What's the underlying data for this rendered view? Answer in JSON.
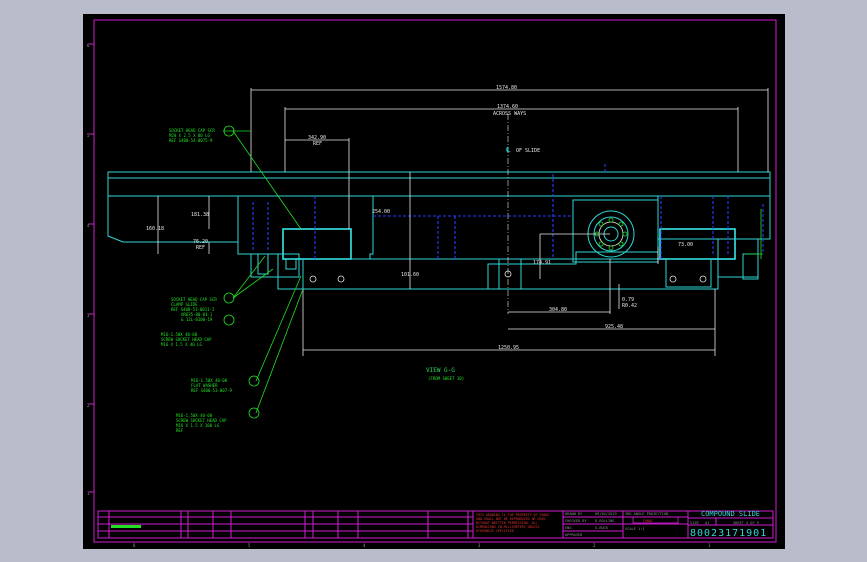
{
  "drawing": {
    "view_title": "VIEW G-G",
    "view_subtitle": "(FROM SHEET 10)",
    "title": "COMPOUND SLIDE",
    "dwg_number": "80023171901",
    "size_label": "SIZE",
    "size_value": "A1",
    "sheet_label": "SHEET 4 OF 9",
    "cl_label": "OF SLIDE"
  },
  "dimensions": {
    "overall": "1574.80",
    "across_ways": "1374.60",
    "across_ways_note": "ACROSS WAYS",
    "top_left": "342.90",
    "top_left_note": "REF",
    "left_height": "160.18",
    "mid_left": "181.38",
    "rail": "76.20",
    "rail_note": "REF",
    "center_height": "254.00",
    "lower_mid": "101.60",
    "right_small": "174.91",
    "right_rail": "73.00",
    "hole": "0.79",
    "hole_note": "R0.42",
    "bottom_1": "304.80",
    "bottom_2": "925.48",
    "bottom_overall": "1250.95"
  },
  "notes": [
    {
      "line1": "SOCKET HEAD CAP SCR",
      "line2": "M20 X 2.5 X 80 LG",
      "line3": "REF S400-54-0075-9"
    },
    {
      "line1": "SOCKET HEAD CAP SCR",
      "line2": "CLAMP SLIDE",
      "line3": "REF S400-53-0011-2"
    },
    {
      "line1": "AR635-80-01-1",
      "line2": "& 12L-0100-19"
    },
    {
      "line1": "M16-1.50X 40-00",
      "line2": "SCREW SOCKET HEAD CAP",
      "line3": "M16 X 1.5 X 40 LG"
    },
    {
      "line1": "M16-1.50X 40-00",
      "line2": "FLAT WASHER",
      "line3": "REF S400-53-007-9"
    },
    {
      "line1": "M16-1.50X 40-00",
      "line2": "SCREW SOCKET HEAD CAP",
      "line3": "M16 X 1.5 X 100 LG",
      "line4": "REF"
    }
  ],
  "ruler_left": [
    "6",
    "5",
    "4",
    "3",
    "2",
    "1"
  ],
  "ruler_bottom": [
    "6",
    "5",
    "4",
    "3",
    "2",
    "1"
  ],
  "title_block": {
    "approvals": [
      "DRAWN BY",
      "CHECKED BY",
      "ENG",
      "APPROVED"
    ],
    "date_col": [
      "09/04/2019",
      "D.ROLLINS",
      "G.BUCK"
    ],
    "fanuc_note": "3RD ANGLE PROJECTION",
    "company": "FANUC",
    "scale": "SCALE 1:1"
  },
  "colors": {
    "border": "#d21cd2",
    "part": "#2fd6d6",
    "hidden": "#2a3cff",
    "leaders": "#22e022",
    "dims": "#e8e8e8",
    "background": "#000000",
    "page": "#b9bccb"
  }
}
